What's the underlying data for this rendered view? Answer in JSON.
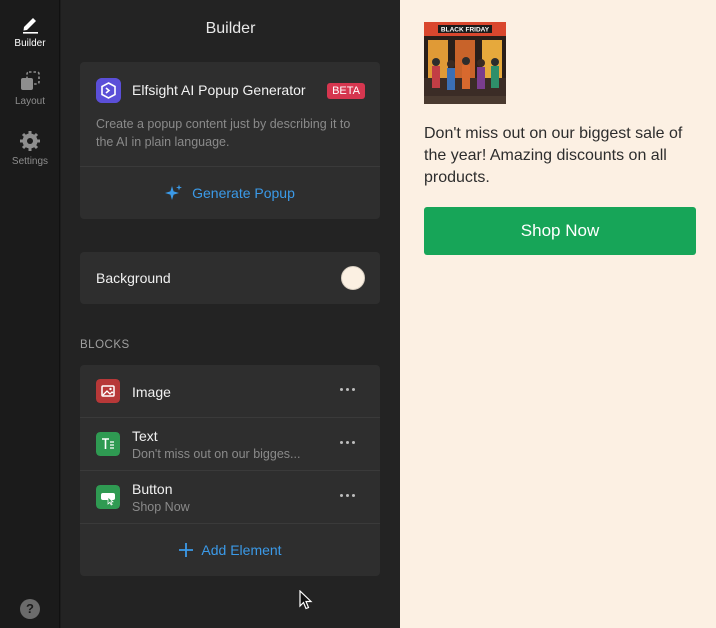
{
  "rail": {
    "builder_label": "Builder",
    "layout_label": "Layout",
    "settings_label": "Settings",
    "help_glyph": "?"
  },
  "panel": {
    "title": "Builder",
    "ai_card": {
      "title": "Elfsight AI Popup Generator",
      "badge": "BETA",
      "description": "Create a popup content just by describing it to the AI in plain language.",
      "action": "Generate Popup"
    },
    "background": {
      "label": "Background",
      "color": "#fbf0e2"
    },
    "blocks_heading": "BLOCKS",
    "blocks": [
      {
        "name": "Image",
        "subtitle": "",
        "icon": "image-icon",
        "color": "#b73838"
      },
      {
        "name": "Text",
        "subtitle": "Don't miss out on our bigges...",
        "icon": "text-icon",
        "color": "#2f9a52"
      },
      {
        "name": "Button",
        "subtitle": "Shop Now",
        "icon": "button-icon",
        "color": "#2f9a52"
      }
    ],
    "add_element": "Add Element"
  },
  "preview": {
    "image_caption": "BLACK FRIDAY",
    "text": "Don't miss out on our biggest sale of the year! Amazing discounts on all products.",
    "button_label": "Shop Now",
    "button_color": "#17a558",
    "background_color": "#fcf0e3"
  },
  "colors": {
    "accent": "#3b9ae8",
    "beta": "#d6364f"
  }
}
